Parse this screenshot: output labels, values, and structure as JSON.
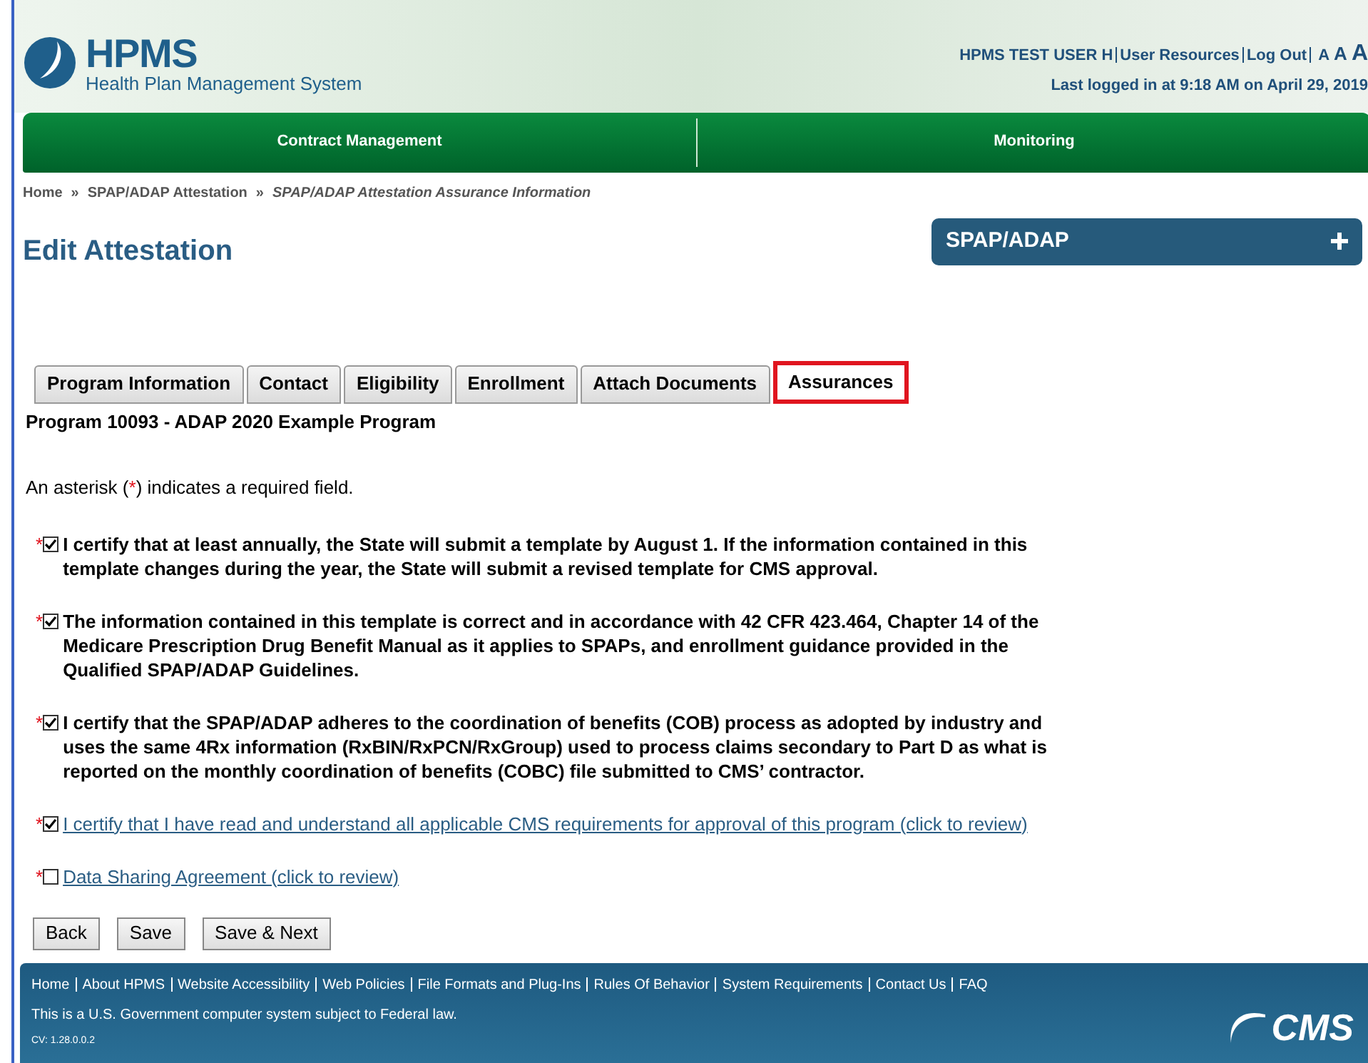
{
  "header": {
    "logo_title": "HPMS",
    "logo_subtitle": "Health Plan Management System",
    "user_links": [
      "HPMS TEST USER H",
      "User Resources",
      "Log Out"
    ],
    "font_sizes": [
      "A",
      "A",
      "A"
    ],
    "last_login": "Last logged in at 9:18 AM on April 29, 2019"
  },
  "nav": [
    "Contract Management",
    "Monitoring"
  ],
  "breadcrumb_separator": "»",
  "breadcrumb": [
    {
      "label": "Home",
      "kind": "link"
    },
    {
      "label": "SPAP/ADAP Attestation",
      "kind": "link"
    },
    {
      "label": "SPAP/ADAP Attestation Assurance Information",
      "kind": "current"
    }
  ],
  "page_title": "Edit Attestation",
  "side_panel": {
    "title": "SPAP/ADAP",
    "expanded": false
  },
  "tabs": [
    {
      "label": "Program Information",
      "selected": false
    },
    {
      "label": "Contact",
      "selected": false
    },
    {
      "label": "Eligibility",
      "selected": false
    },
    {
      "label": "Enrollment",
      "selected": false
    },
    {
      "label": "Attach Documents",
      "selected": false
    },
    {
      "label": "Assurances",
      "selected": true
    }
  ],
  "program_heading": "Program 10093 - ADAP 2020 Example Program",
  "required_note": {
    "before": "An asterisk (",
    "asterisk": "*",
    "after": ") indicates a required field."
  },
  "assurances": [
    {
      "kind": "text",
      "checked": true,
      "text": "I certify that at least annually, the State will submit a template by August 1. If the information contained in this template changes during the year, the State will submit a revised template for CMS approval."
    },
    {
      "kind": "text",
      "checked": true,
      "text": "The information contained in this template is correct and in accordance with 42 CFR 423.464, Chapter 14 of the Medicare Prescription Drug Benefit Manual as it applies to SPAPs, and enrollment guidance provided in the Qualified SPAP/ADAP Guidelines."
    },
    {
      "kind": "text",
      "checked": true,
      "text": "I certify that the SPAP/ADAP adheres to the coordination of benefits (COB) process as adopted by industry and uses the same 4Rx information (RxBIN/RxPCN/RxGroup) used to process claims secondary to Part D as what is reported on the monthly coordination of benefits (COBC) file submitted to CMS’ contractor."
    },
    {
      "kind": "link",
      "checked": true,
      "text": "I certify that I have read and understand all applicable CMS requirements for approval of this program (click to review)"
    },
    {
      "kind": "link",
      "checked": false,
      "text": "Data Sharing Agreement (click to review)"
    }
  ],
  "buttons": [
    "Back",
    "Save",
    "Save & Next"
  ],
  "footer": {
    "links": [
      "Home",
      "About HPMS",
      "Website Accessibility",
      "Web Policies",
      "File Formats and Plug-Ins",
      "Rules Of Behavior",
      "System Requirements",
      "Contact Us",
      "FAQ"
    ],
    "notice": "This is a U.S. Government computer system subject to Federal law.",
    "version": "CV: 1.28.0.0.2",
    "logo": "CMS"
  }
}
